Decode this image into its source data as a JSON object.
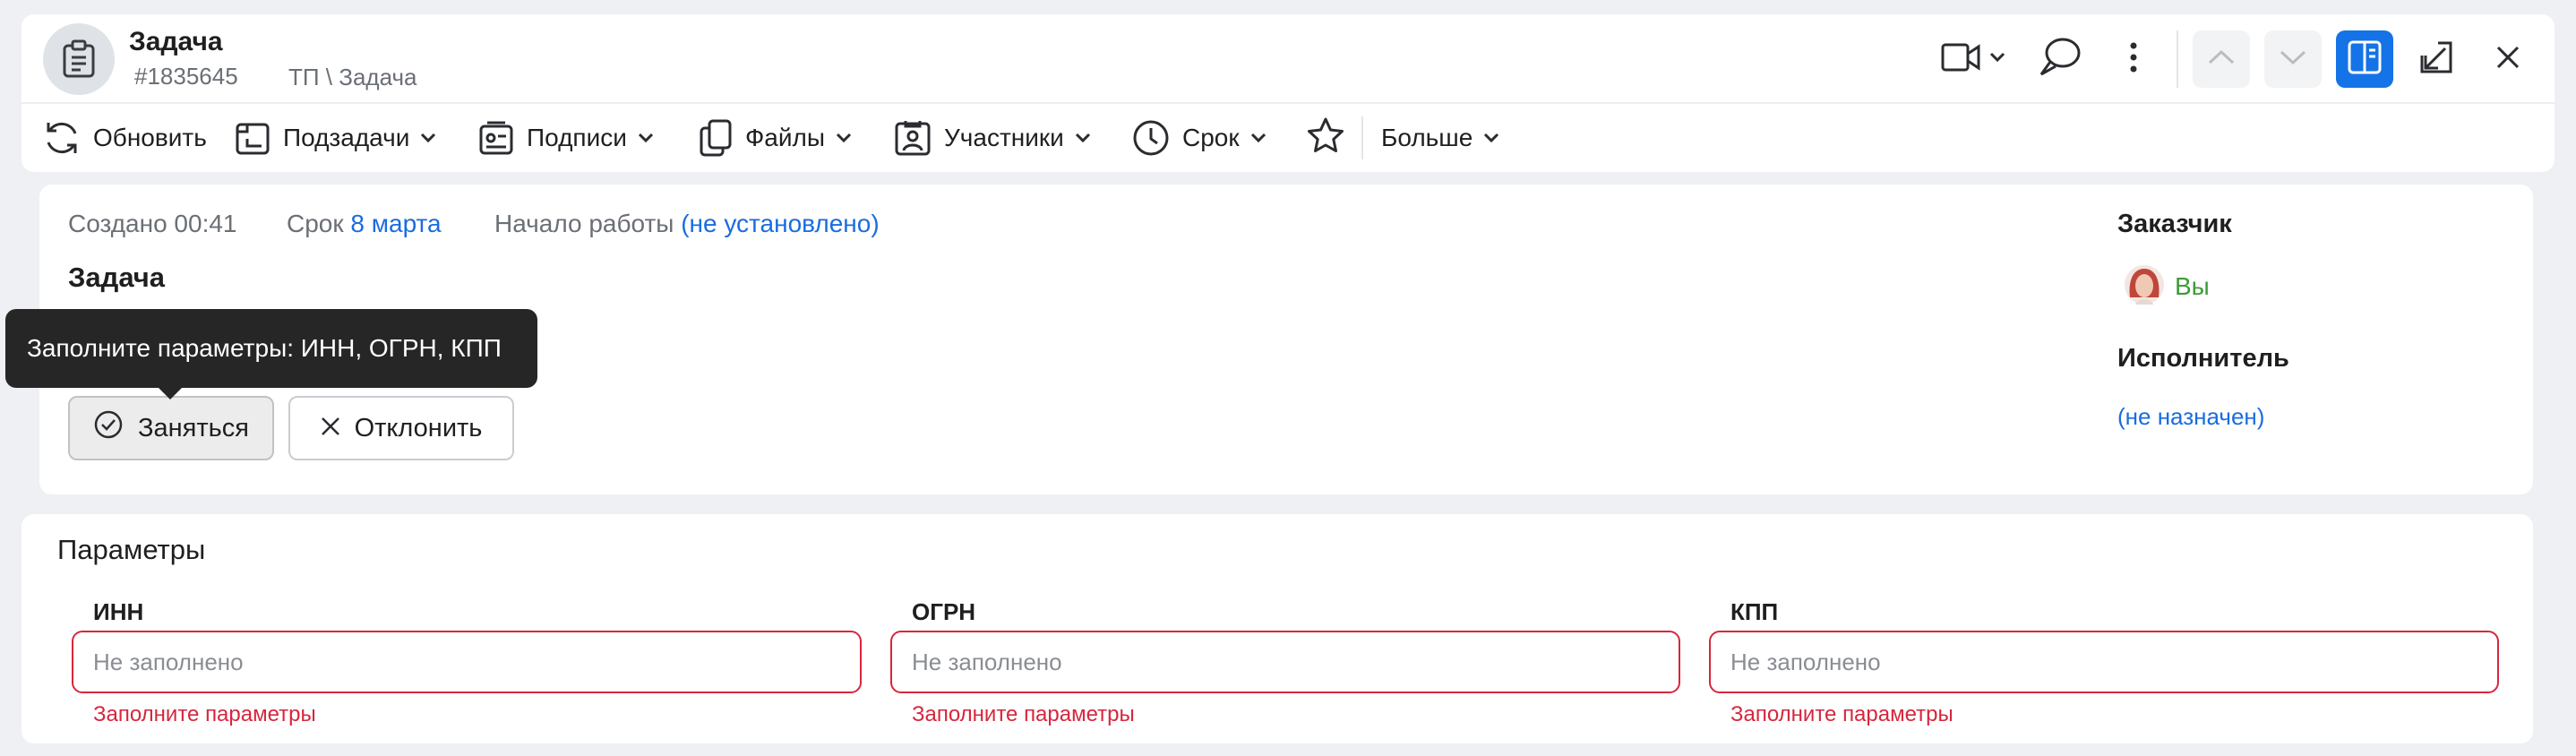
{
  "header": {
    "title": "Задача",
    "number": "#1835645",
    "path": "ТП \\ Задача"
  },
  "toolbar": {
    "refresh": "Обновить",
    "subtasks": "Подзадачи",
    "signatures": "Подписи",
    "files": "Файлы",
    "participants": "Участники",
    "deadline": "Срок",
    "more": "Больше"
  },
  "main": {
    "created_label": "Создано 00:41",
    "deadline_label": "Срок",
    "deadline_value": "8 марта",
    "start_label": "Начало работы",
    "start_value": "(не установлено)",
    "title": "Задача",
    "take_button": "Заняться",
    "decline_button": "Отклонить",
    "tooltip": "Заполните параметры: ИНН, ОГРН, КПП"
  },
  "side": {
    "customer_label": "Заказчик",
    "customer_name": "Вы",
    "assignee_label": "Исполнитель",
    "assignee_value": "(не назначен)"
  },
  "params": {
    "title": "Параметры",
    "fields": [
      {
        "label": "ИНН",
        "placeholder": "Не заполнено",
        "error": "Заполните параметры"
      },
      {
        "label": "ОГРН",
        "placeholder": "Не заполнено",
        "error": "Заполните параметры"
      },
      {
        "label": "КПП",
        "placeholder": "Не заполнено",
        "error": "Заполните параметры"
      }
    ]
  },
  "colors": {
    "accent": "#1473e6",
    "link": "#1a6ce0",
    "error": "#d7263d",
    "customer": "#3f9a3a"
  },
  "icons": [
    "clipboard-icon",
    "video-icon",
    "chat-icon",
    "more-vertical-icon",
    "chevron-up-icon",
    "chevron-down-icon",
    "panel-icon",
    "collapse-icon",
    "close-icon",
    "refresh-icon",
    "subtasks-icon",
    "signature-icon",
    "files-icon",
    "participants-icon",
    "clock-icon",
    "star-icon",
    "check-circle-icon"
  ]
}
